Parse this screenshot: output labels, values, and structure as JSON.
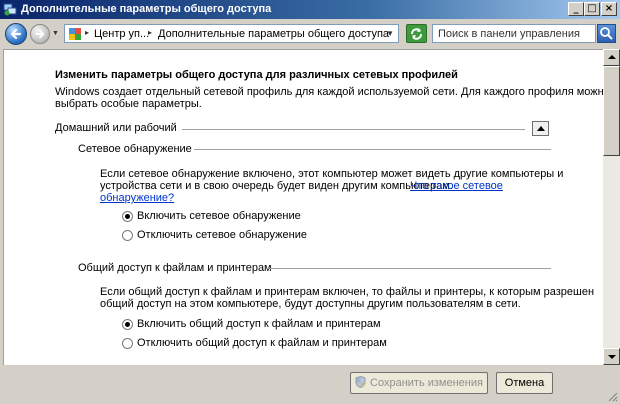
{
  "window": {
    "title": "Дополнительные параметры общего доступа",
    "minimize_glyph": "_",
    "maximize_glyph": "□",
    "close_glyph": "×"
  },
  "addressbar": {
    "crumbs": [
      "Центр уп...",
      "Дополнительные параметры общего доступа"
    ],
    "search_placeholder": "Поиск в панели управления"
  },
  "content": {
    "heading": "Изменить параметры общего доступа для различных сетевых профилей",
    "intro_line1": "Windows создает отдельный сетевой профиль для каждой используемой сети. Для каждого профиля можно",
    "intro_line2": "выбрать особые параметры.",
    "profile": {
      "title": "Домашний или рабочий",
      "sections": {
        "discovery": {
          "title": "Сетевое обнаружение",
          "desc_line1": "Если сетевое обнаружение включено, этот компьютер может видеть другие компьютеры и",
          "desc_line2": "устройства сети и в свою очередь будет виден другим компьютерам.",
          "link_part1": "Что такое сетевое",
          "link_part2": "обнаружение?",
          "options": [
            {
              "label": "Включить сетевое обнаружение",
              "checked": true
            },
            {
              "label": "Отключить сетевое обнаружение",
              "checked": false
            }
          ]
        },
        "file_sharing": {
          "title": "Общий доступ к файлам и принтерам",
          "desc_line1": "Если общий доступ к файлам и принтерам включен, то файлы и принтеры, к которым разрешен",
          "desc_line2": "общий доступ на этом компьютере, будут доступны другим пользователям в сети.",
          "options": [
            {
              "label": "Включить общий доступ к файлам и принтерам",
              "checked": true
            },
            {
              "label": "Отключить общий доступ к файлам и принтерам",
              "checked": false
            }
          ]
        }
      }
    }
  },
  "footer": {
    "save_label": "Сохранить изменения",
    "cancel_label": "Отмена"
  }
}
